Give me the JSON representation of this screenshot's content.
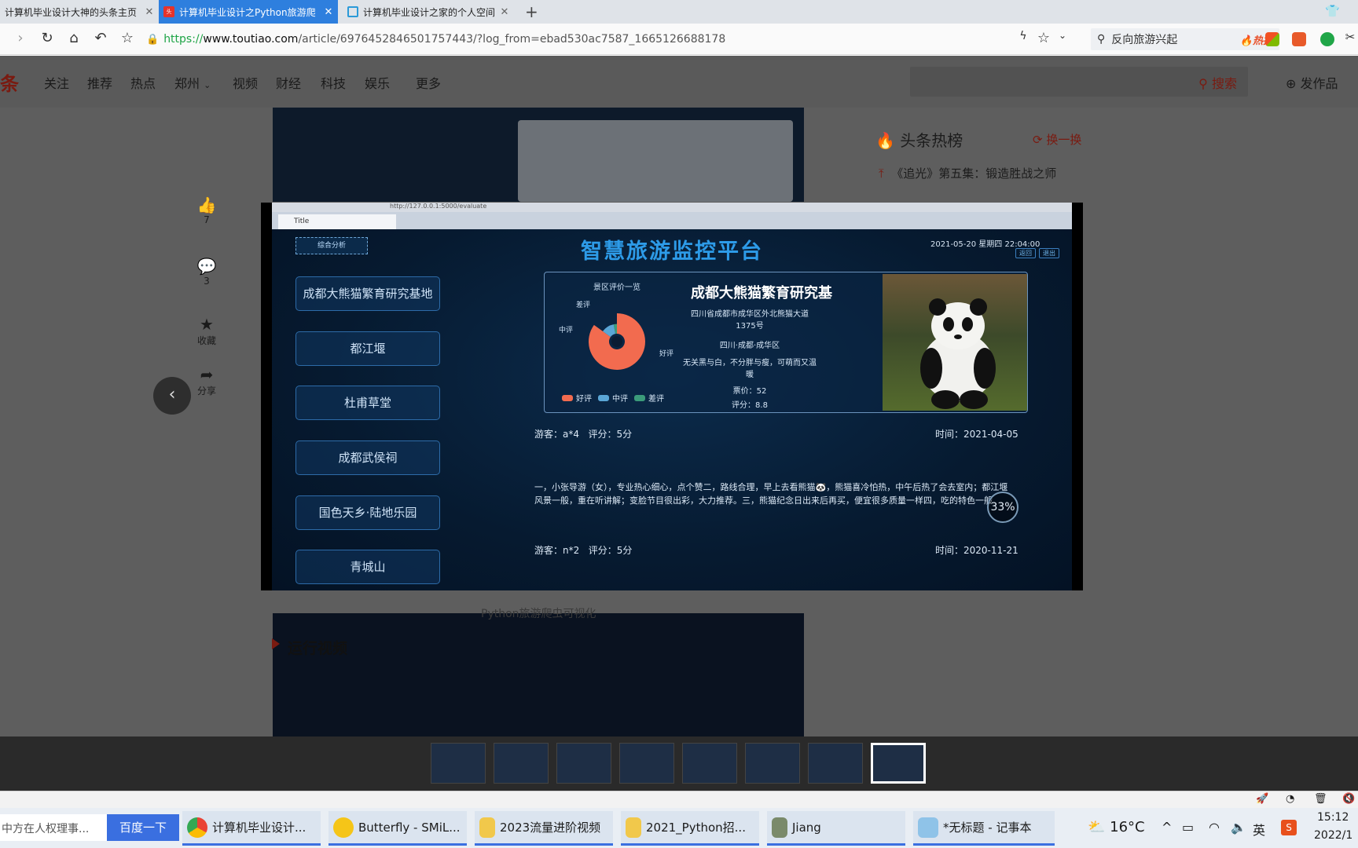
{
  "browser": {
    "tabs": [
      {
        "title": "计算机毕业设计大神的头条主页",
        "active": false
      },
      {
        "title": "计算机毕业设计之Python旅游爬",
        "active": true
      },
      {
        "title": "计算机毕业设计之家的个人空间",
        "active": false
      }
    ],
    "url_scheme": "https://",
    "url_host": "www.toutiao.com",
    "url_path": "/article/6976452846501757443/?log_from=ebad530ac7587_1665126688178",
    "search_query": "反向旅游兴起",
    "search_hot_label": "热搜"
  },
  "site": {
    "logo_fragment": "条",
    "nav": [
      "关注",
      "推荐",
      "热点",
      "郑州",
      "视频",
      "财经",
      "科技",
      "娱乐",
      "更多"
    ],
    "search_label": "搜索",
    "publish_label": "发作品",
    "actions": {
      "like_count": "7",
      "comment_count": "3",
      "collect_label": "收藏",
      "share_label": "分享"
    },
    "hotlist": {
      "title": "头条热榜",
      "refresh_label": "换一换",
      "first_item": "《追光》第五集：锻造胜战之师"
    },
    "image_caption": "Python旅游爬虫可视化",
    "section_title": "运行视频"
  },
  "screenshot": {
    "inner_url": "http://127.0.0.1:5000/evaluate",
    "inner_tab_title": "Title",
    "dashboard_title": "智慧旅游监控平台",
    "datetime": "2021-05-20  星期四  22:04:00",
    "back_label": "返回",
    "exit_label": "退出",
    "analysis_button": "综合分析",
    "sights": [
      "成都大熊猫繁育研究基地",
      "都江堰",
      "杜甫草堂",
      "成都武侯祠",
      "国色天乡·陆地乐园",
      "青城山"
    ],
    "pie_title": "景区评价一览",
    "pie_labels": {
      "good": "好评",
      "medium": "中评",
      "bad": "差评"
    },
    "spot": {
      "name": "成都大熊猫繁育研究基",
      "address": "四川省成都市成华区外北熊猫大道1375号",
      "region": "四川·成都·成华区",
      "slogan": "无关黑与白，不分胖与瘦，可萌而又温暖",
      "price": "票价：52",
      "score": "评分：8.8"
    },
    "reviews": [
      {
        "visitor": "游客：a*4",
        "rating": "评分：5分",
        "time": "时间：2021-04-05",
        "text": "一，小张导游（女），专业热心细心，点个赞二，路线合理，早上去看熊猫🐼，熊猫喜冷怕热，中午后热了会去室内；都江堰风景一般，重在听讲解；变脸节目很出彩，大力推荐。三，熊猫纪念日出来后再买，便宜很多质量一样四，吃的特色一般"
      },
      {
        "visitor": "游客：n*2",
        "rating": "评分：5分",
        "time": "时间：2020-11-21"
      }
    ],
    "speed_percent": "33%"
  },
  "taskbar": {
    "search_placeholder": "中方在人权理事...",
    "search_button": "百度一下",
    "apps": [
      "计算机毕业设计...",
      "Butterfly - SMiL...",
      "2023流量进阶视频",
      "2021_Python招...",
      "Jiang",
      "*无标题 - 记事本"
    ],
    "temperature": "16°C",
    "ime": "英",
    "clock_time": "15:12",
    "clock_date": "2022/1"
  },
  "chart_data": {
    "type": "pie",
    "title": "景区评价一览",
    "categories": [
      "好评",
      "中评",
      "差评"
    ],
    "values": [
      85,
      12,
      3
    ],
    "colors": [
      "#f26b4f",
      "#5aa6d6",
      "#3b9b7a"
    ]
  }
}
